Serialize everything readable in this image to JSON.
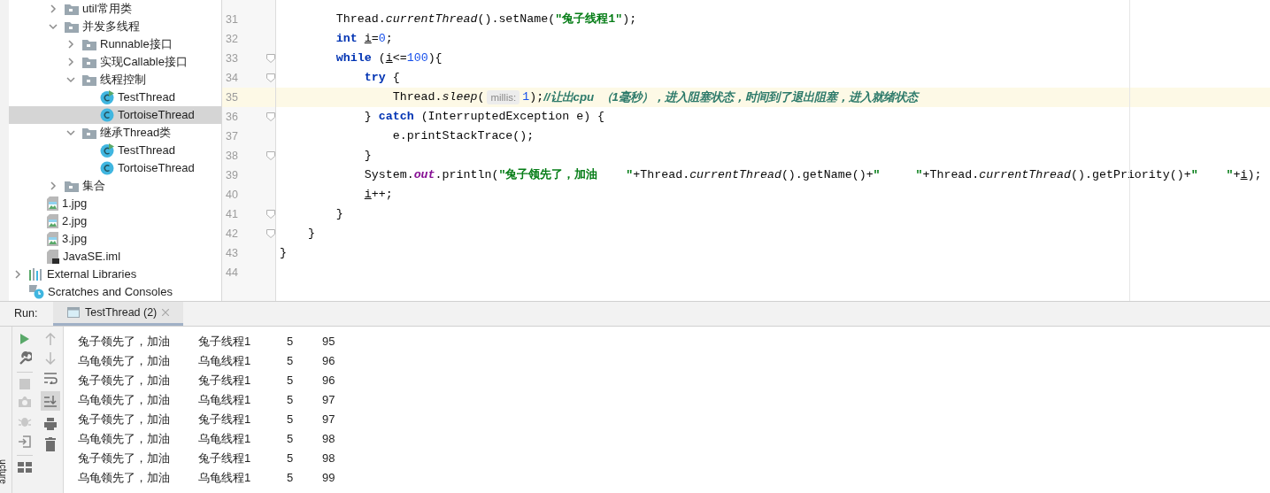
{
  "project_tree": {
    "source_items": [
      {
        "kind": "folder",
        "label": "util常用类",
        "expanded": false,
        "selected": false
      },
      {
        "kind": "folder",
        "label": "并发多线程",
        "expanded": true,
        "selected": false,
        "children": [
          {
            "kind": "folder",
            "label": "Runnable接口",
            "expanded": false,
            "selected": false
          },
          {
            "kind": "folder",
            "label": "实现Callable接口",
            "expanded": false,
            "selected": false
          },
          {
            "kind": "folder",
            "label": "线程控制",
            "expanded": true,
            "selected": false,
            "children": [
              {
                "kind": "runnable-class",
                "label": "TestThread",
                "selected": false
              },
              {
                "kind": "class",
                "label": "TortoiseThread",
                "selected": true
              }
            ]
          },
          {
            "kind": "folder",
            "label": "继承Thread类",
            "expanded": true,
            "selected": false,
            "children": [
              {
                "kind": "runnable-class",
                "label": "TestThread",
                "selected": false
              },
              {
                "kind": "class",
                "label": "TortoiseThread",
                "selected": false
              }
            ]
          }
        ]
      },
      {
        "kind": "folder",
        "label": "集合",
        "expanded": false,
        "selected": false
      }
    ],
    "module_files": [
      {
        "kind": "image",
        "label": "1.jpg",
        "selected": false
      },
      {
        "kind": "image",
        "label": "2.jpg",
        "selected": false
      },
      {
        "kind": "image",
        "label": "3.jpg",
        "selected": false
      },
      {
        "kind": "module",
        "label": "JavaSE.iml",
        "selected": false
      }
    ],
    "top_items": [
      {
        "kind": "libraries",
        "label": "External Libraries",
        "expanded": false,
        "selected": false
      },
      {
        "kind": "scratches",
        "label": "Scratches and Consoles",
        "selected": false
      }
    ]
  },
  "editor": {
    "lines": [
      {
        "number": "31",
        "fold": false,
        "current": false,
        "tokens": [
          {
            "kind": "plain",
            "text": "        Thread."
          },
          {
            "kind": "static",
            "text": "currentThread"
          },
          {
            "kind": "plain",
            "text": "().setName("
          },
          {
            "kind": "string",
            "text": "\"兔子线程1\""
          },
          {
            "kind": "plain",
            "text": ");"
          }
        ]
      },
      {
        "number": "32",
        "fold": false,
        "current": false,
        "tokens": [
          {
            "kind": "keyword",
            "text": "        int "
          },
          {
            "kind": "var",
            "text": "i"
          },
          {
            "kind": "plain",
            "text": "="
          },
          {
            "kind": "number",
            "text": "0"
          },
          {
            "kind": "plain",
            "text": ";"
          }
        ]
      },
      {
        "number": "33",
        "fold": true,
        "current": false,
        "tokens": [
          {
            "kind": "keyword",
            "text": "        while"
          },
          {
            "kind": "plain",
            "text": " ("
          },
          {
            "kind": "var",
            "text": "i"
          },
          {
            "kind": "plain",
            "text": "<="
          },
          {
            "kind": "number",
            "text": "100"
          },
          {
            "kind": "plain",
            "text": "){"
          }
        ]
      },
      {
        "number": "34",
        "fold": true,
        "current": false,
        "tokens": [
          {
            "kind": "keyword",
            "text": "            try"
          },
          {
            "kind": "plain",
            "text": " {"
          }
        ]
      },
      {
        "number": "35",
        "fold": false,
        "current": true,
        "tokens": [
          {
            "kind": "plain",
            "text": "                Thread."
          },
          {
            "kind": "static",
            "text": "sleep"
          },
          {
            "kind": "plain",
            "text": "("
          },
          {
            "kind": "hint",
            "text": "millis:"
          },
          {
            "kind": "number",
            "text": "1"
          },
          {
            "kind": "plain",
            "text": ");"
          },
          {
            "kind": "comment",
            "text": "//让出cpu  （1毫秒），进入阻塞状态，时间到了退出阻塞，进入就绪状态"
          }
        ]
      },
      {
        "number": "36",
        "fold": true,
        "current": false,
        "tokens": [
          {
            "kind": "plain",
            "text": "            } "
          },
          {
            "kind": "keyword",
            "text": "catch"
          },
          {
            "kind": "plain",
            "text": " (InterruptedException e) {"
          }
        ]
      },
      {
        "number": "37",
        "fold": false,
        "current": false,
        "tokens": [
          {
            "kind": "plain",
            "text": "                e.printStackTrace();"
          }
        ]
      },
      {
        "number": "38",
        "fold": true,
        "current": false,
        "tokens": [
          {
            "kind": "plain",
            "text": "            }"
          }
        ]
      },
      {
        "number": "39",
        "fold": false,
        "current": false,
        "tokens": [
          {
            "kind": "plain",
            "text": "            System."
          },
          {
            "kind": "field",
            "text": "out"
          },
          {
            "kind": "plain",
            "text": ".println("
          },
          {
            "kind": "string",
            "text": "\"兔子领先了，加油    \""
          },
          {
            "kind": "plain",
            "text": "+Thread."
          },
          {
            "kind": "static",
            "text": "currentThread"
          },
          {
            "kind": "plain",
            "text": "().getName()+"
          },
          {
            "kind": "string",
            "text": "\"     \""
          },
          {
            "kind": "plain",
            "text": "+Thread."
          },
          {
            "kind": "static",
            "text": "currentThread"
          },
          {
            "kind": "plain",
            "text": "().getPriority()+"
          },
          {
            "kind": "string",
            "text": "\"    \""
          },
          {
            "kind": "plain",
            "text": "+"
          },
          {
            "kind": "var",
            "text": "i"
          },
          {
            "kind": "plain",
            "text": ");"
          }
        ]
      },
      {
        "number": "40",
        "fold": false,
        "current": false,
        "tokens": [
          {
            "kind": "var",
            "text": "            i"
          },
          {
            "kind": "plain",
            "text": "++;"
          }
        ]
      },
      {
        "number": "41",
        "fold": true,
        "current": false,
        "tokens": [
          {
            "kind": "plain",
            "text": "        }"
          }
        ]
      },
      {
        "number": "42",
        "fold": true,
        "current": false,
        "tokens": [
          {
            "kind": "plain",
            "text": "    }"
          }
        ]
      },
      {
        "number": "43",
        "fold": false,
        "current": false,
        "tokens": [
          {
            "kind": "plain",
            "text": "}"
          }
        ]
      },
      {
        "number": "44",
        "fold": false,
        "current": false
      }
    ]
  },
  "run_panel": {
    "label": "Run:",
    "tabs": [
      {
        "label": "TestThread (2)",
        "selected": true
      }
    ],
    "side_tab": "ucture",
    "console_rows": [
      [
        "兔子领先了，加油",
        "兔子线程1",
        "5",
        "95"
      ],
      [
        "乌龟领先了，加油",
        "乌龟线程1",
        "5",
        "96"
      ],
      [
        "兔子领先了，加油",
        "兔子线程1",
        "5",
        "96"
      ],
      [
        "乌龟领先了，加油",
        "乌龟线程1",
        "5",
        "97"
      ],
      [
        "兔子领先了，加油",
        "兔子线程1",
        "5",
        "97"
      ],
      [
        "乌龟领先了，加油",
        "乌龟线程1",
        "5",
        "98"
      ],
      [
        "兔子领先了，加油",
        "兔子线程1",
        "5",
        "98"
      ],
      [
        "乌龟领先了，加油",
        "乌龟线程1",
        "5",
        "99"
      ]
    ]
  }
}
